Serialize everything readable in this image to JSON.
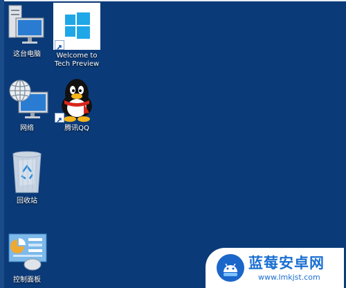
{
  "desktop": {
    "background_color": "#0b3a78",
    "icons": [
      {
        "label": "这台电脑",
        "icon": "this-pc-icon"
      },
      {
        "label": "Welcome to Tech Preview",
        "icon": "windows-logo-icon",
        "shortcut": true
      },
      {
        "label": "网络",
        "icon": "network-icon"
      },
      {
        "label": "腾讯QQ",
        "icon": "qq-penguin-icon",
        "shortcut": true
      },
      {
        "label": "回收站",
        "icon": "recycle-bin-icon"
      },
      {
        "label": "控制面板",
        "icon": "control-panel-icon"
      }
    ]
  },
  "watermark": {
    "brand": "蓝莓安卓网",
    "url": "www.lmkjst.com"
  }
}
